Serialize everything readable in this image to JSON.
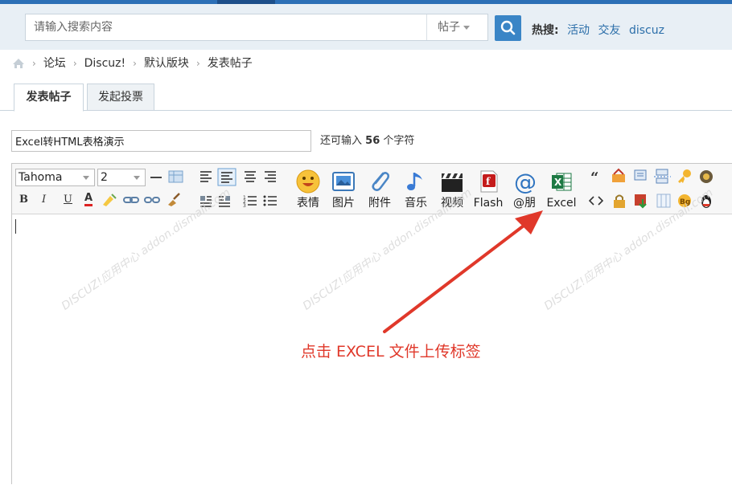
{
  "search": {
    "placeholder": "请输入搜索内容",
    "type_label": "帖子",
    "hot_label": "热搜:",
    "hot_links": [
      "活动",
      "交友",
      "discuz"
    ]
  },
  "breadcrumb": {
    "items": [
      "论坛",
      "Discuz!",
      "默认版块",
      "发表帖子"
    ]
  },
  "tabs": {
    "post": "发表帖子",
    "poll": "发起投票"
  },
  "subject": {
    "value": "Excel转HTML表格演示",
    "remaining_prefix": "还可输入",
    "remaining_count": "56",
    "remaining_suffix": "个字符"
  },
  "editor": {
    "font": "Tahoma",
    "size": "2",
    "buttons": {
      "emoji": "表情",
      "image": "图片",
      "attach": "附件",
      "music": "音乐",
      "video": "视频",
      "flash": "Flash",
      "at": "@朋",
      "excel": "Excel"
    },
    "format": {
      "bold": "B",
      "italic": "I",
      "underline": "U",
      "color": "A"
    }
  },
  "watermark": "DISCUZ!应用中心 addon.dismall.com",
  "annotation": "点击 EXCEL 文件上传标签",
  "colors": {
    "topbar": "#2c6fb6",
    "search_button": "#3a85c6",
    "link": "#2b6ea9",
    "annotation": "#e0382a"
  }
}
